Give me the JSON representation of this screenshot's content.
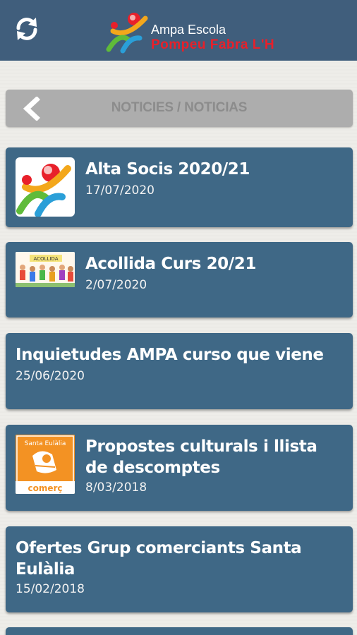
{
  "header": {
    "refresh_icon": "refresh-icon",
    "logo_line1": "Ampa Escola",
    "logo_line2": "Pompeu Fabra L'H",
    "bg_color": "#405e7c",
    "brand_red": "#e8202a"
  },
  "section": {
    "back_icon": "chevron-left-icon",
    "title": "NOTICIES / NOTICIAS"
  },
  "news": [
    {
      "title": "Alta Socis 2020/21",
      "date": "17/07/2020",
      "thumb": "ampa-logo"
    },
    {
      "title": "Acollida Curs 20/21",
      "date": "2/07/2020",
      "thumb": "kids-drawing"
    },
    {
      "title": "Inquietudes AMPA curso que viene",
      "date": "25/06/2020",
      "thumb": ""
    },
    {
      "title": "Propostes culturals i llista de descomptes",
      "date": "8/03/2018",
      "thumb": "santa-eulalia-comerc-logo"
    },
    {
      "title": "Ofertes Grup comerciants Santa Eulàlia",
      "date": "15/02/2018",
      "thumb": ""
    }
  ],
  "thumbs": {
    "kids_banner_text": "ACOLLIDA",
    "santa_top": "Santa Eulàlia",
    "santa_bottom": "comerç"
  }
}
